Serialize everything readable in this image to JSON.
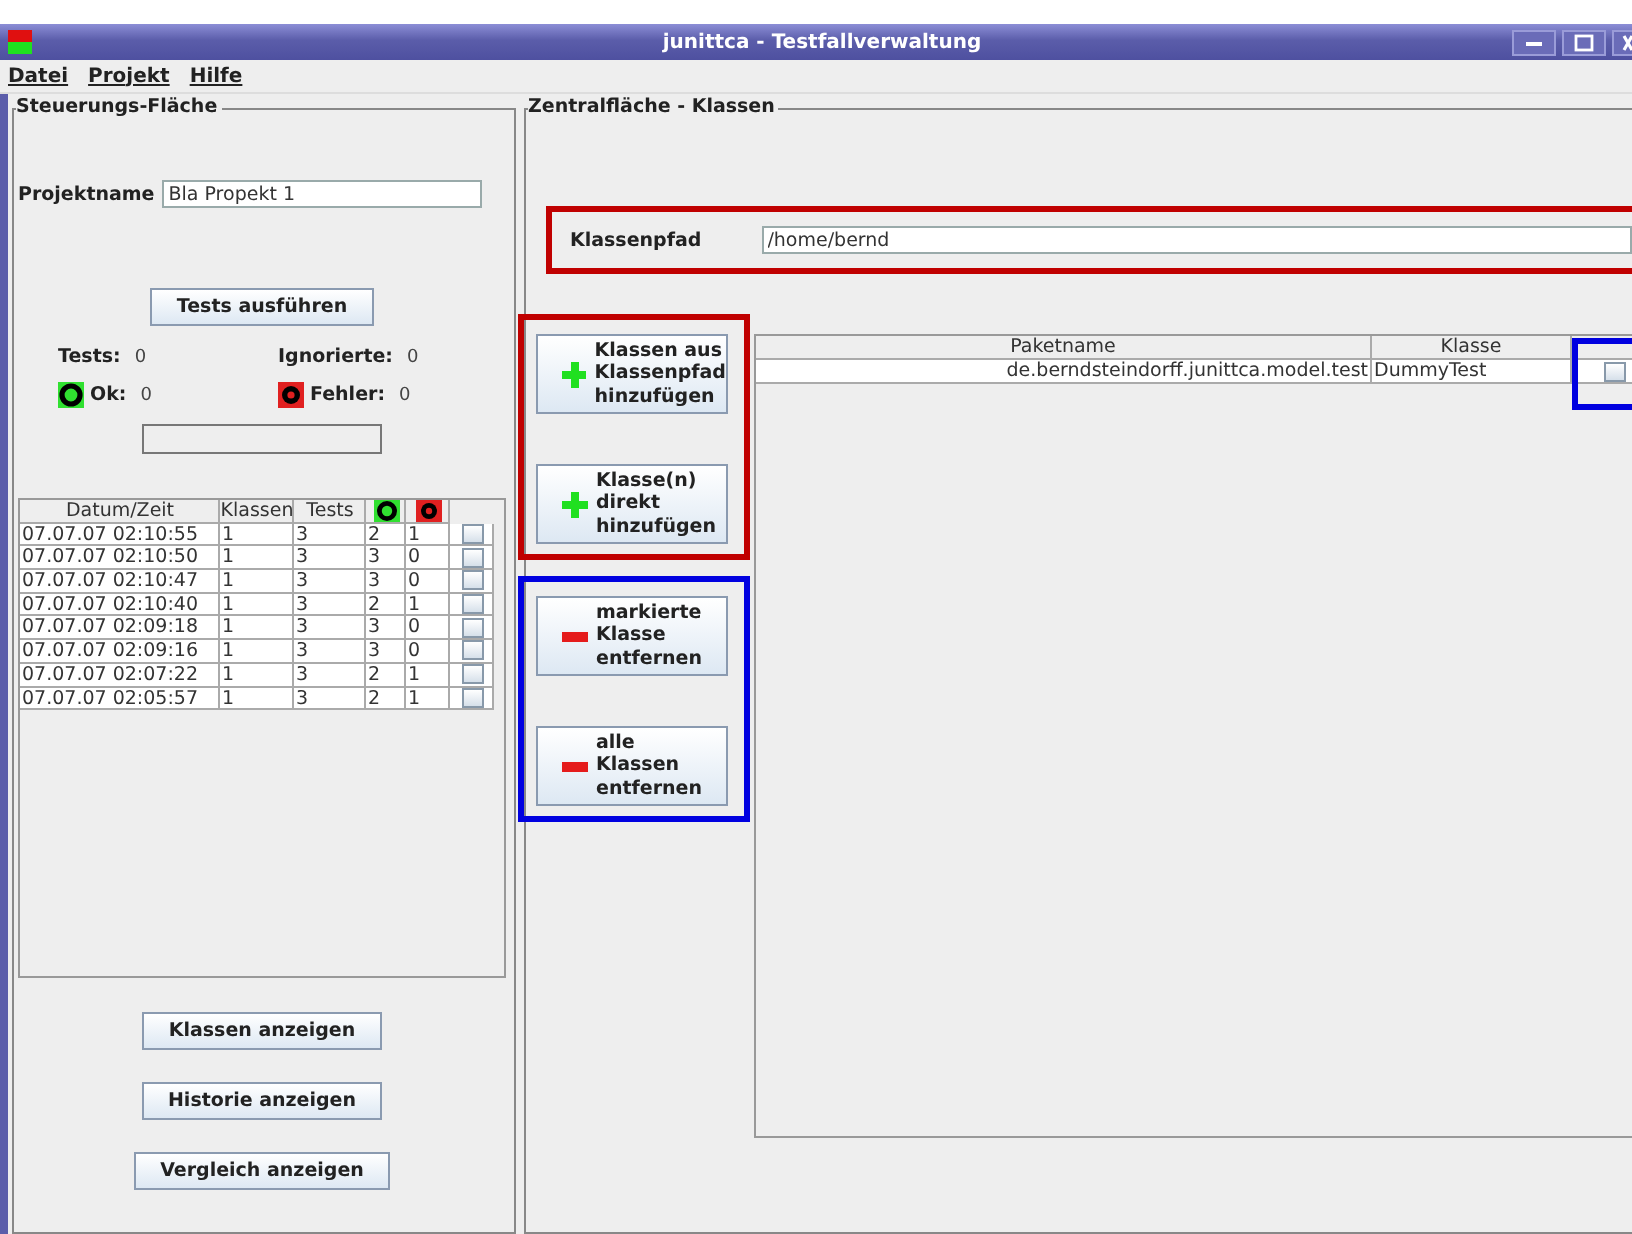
{
  "window": {
    "title": "junittca - Testfallverwaltung"
  },
  "menu": [
    {
      "label": "Datei"
    },
    {
      "label": "Projekt"
    },
    {
      "label": "Hilfe"
    }
  ],
  "control_panel": {
    "title": "Steuerungs-Fläche",
    "project_label": "Projektname",
    "project_value": "Bla Propekt 1",
    "run_button": "Tests ausführen",
    "stats": {
      "tests_label": "Tests:",
      "tests_value": "0",
      "ignored_label": "Ignorierte:",
      "ignored_value": "0",
      "ok_label": "Ok:",
      "ok_value": "0",
      "errors_label": "Fehler:",
      "errors_value": "0"
    },
    "history": {
      "columns": [
        "Datum/Zeit",
        "Klassen",
        "Tests"
      ],
      "rows": [
        {
          "date": "07.07.07 02:10:55",
          "classes": "1",
          "tests": "3",
          "ok": "2",
          "errors": "1",
          "checked": false
        },
        {
          "date": "07.07.07 02:10:50",
          "classes": "1",
          "tests": "3",
          "ok": "3",
          "errors": "0",
          "checked": false
        },
        {
          "date": "07.07.07 02:10:47",
          "classes": "1",
          "tests": "3",
          "ok": "3",
          "errors": "0",
          "checked": false
        },
        {
          "date": "07.07.07 02:10:40",
          "classes": "1",
          "tests": "3",
          "ok": "2",
          "errors": "1",
          "checked": false
        },
        {
          "date": "07.07.07 02:09:18",
          "classes": "1",
          "tests": "3",
          "ok": "3",
          "errors": "0",
          "checked": false
        },
        {
          "date": "07.07.07 02:09:16",
          "classes": "1",
          "tests": "3",
          "ok": "3",
          "errors": "0",
          "checked": false
        },
        {
          "date": "07.07.07 02:07:22",
          "classes": "1",
          "tests": "3",
          "ok": "2",
          "errors": "1",
          "checked": false
        },
        {
          "date": "07.07.07 02:05:57",
          "classes": "1",
          "tests": "3",
          "ok": "2",
          "errors": "1",
          "checked": false
        }
      ]
    },
    "buttons": [
      "Klassen anzeigen",
      "Historie anzeigen",
      "Vergleich anzeigen"
    ]
  },
  "central_panel": {
    "title": "Zentralfläche - Klassen",
    "classpath_label": "Klassenpfad",
    "classpath_value": "/home/bernd",
    "actions": [
      {
        "kind": "add",
        "lines": [
          "Klassen aus",
          "Klassenpfad",
          "hinzufügen"
        ]
      },
      {
        "kind": "add",
        "lines": [
          "Klasse(n)",
          "direkt",
          "hinzufügen"
        ]
      },
      {
        "kind": "remove",
        "lines": [
          "markierte",
          "Klasse",
          "entfernen"
        ]
      },
      {
        "kind": "remove",
        "lines": [
          "alle",
          "Klassen",
          "entfernen"
        ]
      }
    ],
    "classes": {
      "columns": [
        "Paketname",
        "Klasse"
      ],
      "rows": [
        {
          "package": "de.berndsteindorff.junittca.model.test",
          "class": "DummyTest",
          "checked": false
        }
      ]
    }
  }
}
